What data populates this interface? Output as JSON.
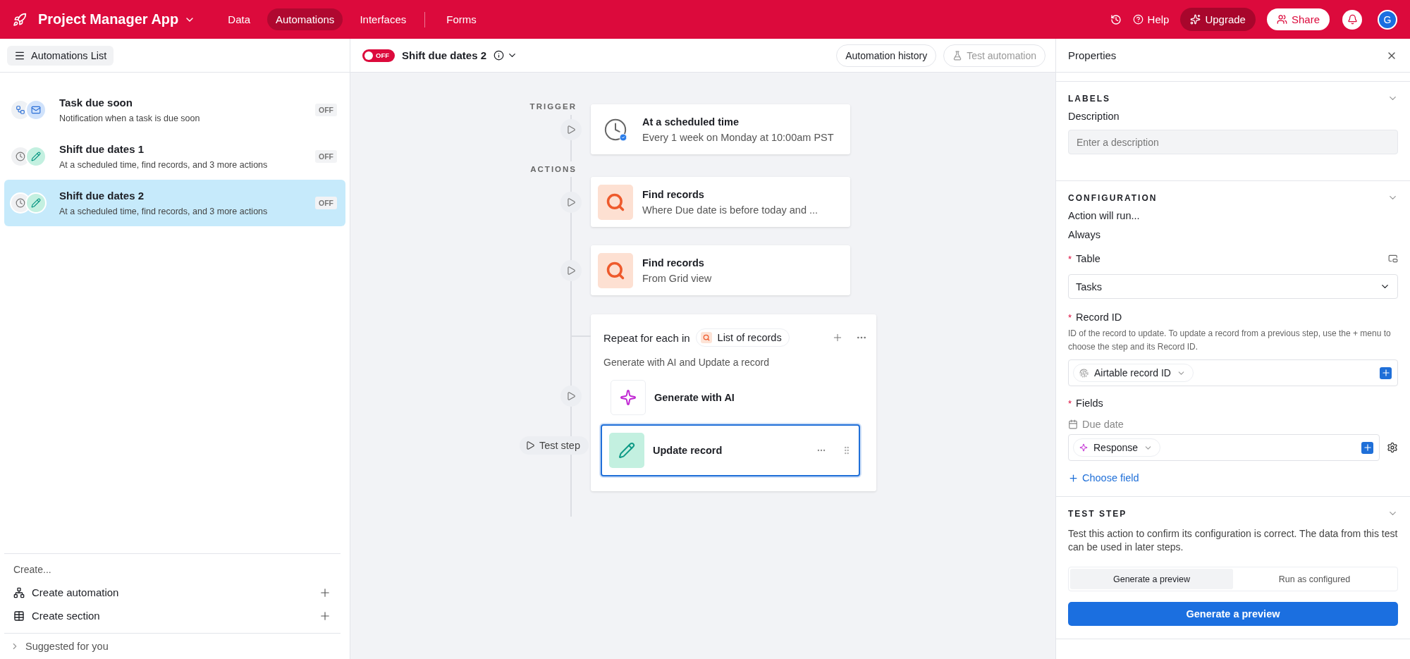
{
  "topbar": {
    "app_name": "Project Manager App",
    "nav": [
      {
        "label": "Data",
        "selected": false
      },
      {
        "label": "Automations",
        "selected": true
      },
      {
        "label": "Interfaces",
        "selected": false
      },
      {
        "label": "Forms",
        "selected": false
      }
    ],
    "help": "Help",
    "upgrade": "Upgrade",
    "share": "Share",
    "avatar": "G"
  },
  "sidebar": {
    "header": "Automations List",
    "automations": [
      {
        "name": "Task due soon",
        "description": "Notification when a task is due soon",
        "status": "OFF",
        "kind": "notify",
        "selected": false
      },
      {
        "name": "Shift due dates 1",
        "description": "At a scheduled time, find records, and 3 more actions",
        "status": "OFF",
        "kind": "update",
        "selected": false
      },
      {
        "name": "Shift due dates 2",
        "description": "At a scheduled time, find records, and 3 more actions",
        "status": "OFF",
        "kind": "update",
        "selected": true
      }
    ],
    "create_heading": "Create...",
    "create_items": [
      {
        "label": "Create automation",
        "kind": "automation"
      },
      {
        "label": "Create section",
        "kind": "section"
      }
    ],
    "suggested": "Suggested for you"
  },
  "toolbar": {
    "toggle": {
      "label": "OFF",
      "on": false
    },
    "title": "Shift due dates 2",
    "history": "Automation history",
    "test": {
      "label": "Test automation",
      "disabled": true
    }
  },
  "flow": {
    "trigger_label": "TRIGGER",
    "trigger": {
      "title": "At a scheduled time",
      "subtitle": "Every 1 week on Monday at 10:00am PST"
    },
    "actions_label": "ACTIONS",
    "actions": [
      {
        "title": "Find records",
        "subtitle": "Where Due date is before today and ..."
      },
      {
        "title": "Find records",
        "subtitle": "From Grid view"
      }
    ],
    "repeat": {
      "prefix": "Repeat for each in",
      "source": "List of records",
      "description": "Generate with AI and Update a record",
      "steps": [
        {
          "title": "Generate with AI",
          "kind": "ai",
          "selected": false
        },
        {
          "title": "Update record",
          "kind": "update",
          "selected": true
        }
      ]
    },
    "test_step": "Test step"
  },
  "properties": {
    "title": "Properties",
    "labels": {
      "heading": "LABELS",
      "description_label": "Description",
      "description_placeholder": "Enter a description"
    },
    "configuration": {
      "heading": "CONFIGURATION",
      "run_label": "Action will run...",
      "run_value": "Always",
      "table": {
        "mark": "*",
        "label": "Table",
        "value": "Tasks"
      },
      "record": {
        "mark": "*",
        "label": "Record ID",
        "help": "ID of the record to update. To update a record from a previous step, use the + menu to choose the step and its Record ID.",
        "token": "Airtable record ID"
      },
      "fields": {
        "mark": "*",
        "label": "Fields",
        "items": [
          {
            "name": "Due date",
            "token": "Response"
          }
        ],
        "choose": "Choose field"
      }
    },
    "test_step": {
      "heading": "TEST STEP",
      "description": "Test this action to confirm its configuration is correct. The data from this test can be used in later steps.",
      "modes": [
        {
          "label": "Generate a preview",
          "selected": true
        },
        {
          "label": "Run as configured",
          "selected": false
        }
      ],
      "button": "Generate a preview"
    }
  }
}
